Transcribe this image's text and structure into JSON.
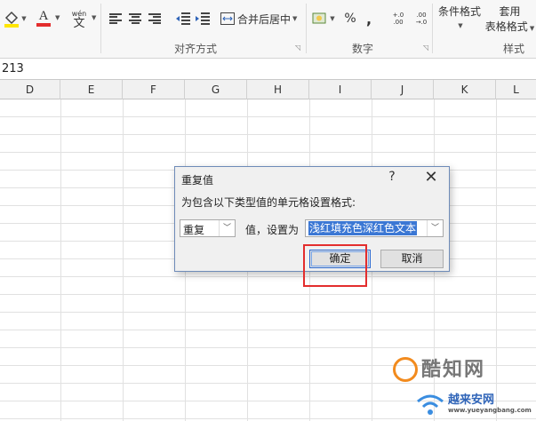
{
  "ribbon": {
    "font_color_letter": "A",
    "phonetic_label": "wén",
    "phonetic_char": "文",
    "merge_label": "合并后居中",
    "percent": "%",
    "comma": ",",
    "increase_decimal": "+.0 .00",
    "decrease_decimal": ".00 →.0",
    "conditional_format": "条件格式",
    "table_format_top": "套用",
    "table_format_bottom": "表格格式",
    "group_alignment": "对齐方式",
    "group_number": "数字",
    "group_styles": "样式"
  },
  "formula_bar": {
    "value": "213"
  },
  "columns": [
    "D",
    "E",
    "F",
    "G",
    "H",
    "I",
    "J",
    "K",
    "L"
  ],
  "dialog": {
    "title": "重复值",
    "help": "?",
    "close": "✕",
    "prompt": "为包含以下类型值的单元格设置格式:",
    "type_value": "重复",
    "middle_text": "值，设置为",
    "format_value": "浅红填充色深红色文本",
    "ok_label": "确定",
    "cancel_label": "取消"
  },
  "watermark": {
    "name": "酷知网",
    "sub": "越来安网",
    "domain": "www.yueyangbang.com"
  },
  "colors": {
    "font_color_bar": "#e32d2d",
    "highlight": "#e32d2d",
    "selection": "#3b77d4",
    "watermark_orange": "#f28b1e",
    "watermark_blue": "#2f64b8"
  }
}
